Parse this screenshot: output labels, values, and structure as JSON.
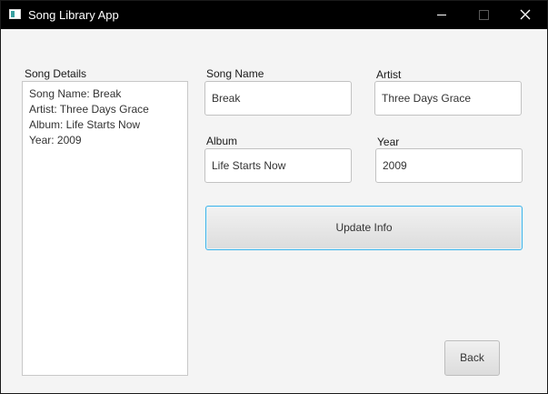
{
  "window": {
    "title": "Song Library App"
  },
  "details": {
    "label": "Song Details",
    "lines": [
      "Song Name: Break",
      "Artist: Three Days Grace",
      "Album: Life Starts Now",
      "Year: 2009"
    ]
  },
  "form": {
    "song_name": {
      "label": "Song Name",
      "value": "Break"
    },
    "artist": {
      "label": "Artist",
      "value": "Three Days Grace"
    },
    "album": {
      "label": "Album",
      "value": "Life Starts Now"
    },
    "year": {
      "label": "Year",
      "value": "2009"
    }
  },
  "buttons": {
    "update": "Update Info",
    "back": "Back"
  },
  "icons": {
    "app": "app-window-icon",
    "minimize": "minimize-icon",
    "maximize": "maximize-icon",
    "close": "close-icon"
  },
  "colors": {
    "titlebar": "#000000",
    "window_bg": "#f4f4f4",
    "focus_accent": "#3fb3e8"
  }
}
